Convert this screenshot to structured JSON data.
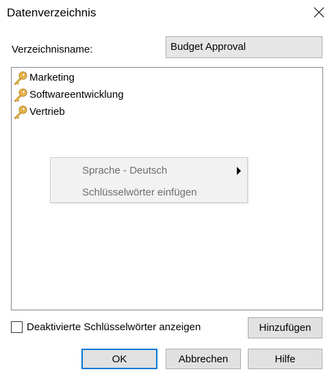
{
  "window": {
    "title": "Datenverzeichnis",
    "close_icon": "close-icon"
  },
  "directory": {
    "label": "Verzeichnisname:",
    "value": "Budget Approval"
  },
  "list": {
    "item_icon": "key-icon",
    "items": [
      {
        "label": "Marketing"
      },
      {
        "label": "Softwareentwicklung"
      },
      {
        "label": "Vertrieb"
      }
    ]
  },
  "context_menu": {
    "items": [
      {
        "label": "Sprache - Deutsch",
        "has_submenu": true
      },
      {
        "label": "Schlüsselwörter einfügen",
        "has_submenu": false
      }
    ]
  },
  "options": {
    "show_disabled_label": "Deaktivierte Schlüsselwörter anzeigen",
    "show_disabled_checked": false
  },
  "buttons": {
    "add": "Hinzufügen",
    "ok": "OK",
    "cancel": "Abbrechen",
    "help": "Hilfe"
  },
  "colors": {
    "key_gold": "#e8b84a",
    "focus_blue": "#0078d7",
    "disabled_text": "#6d6d6d"
  }
}
